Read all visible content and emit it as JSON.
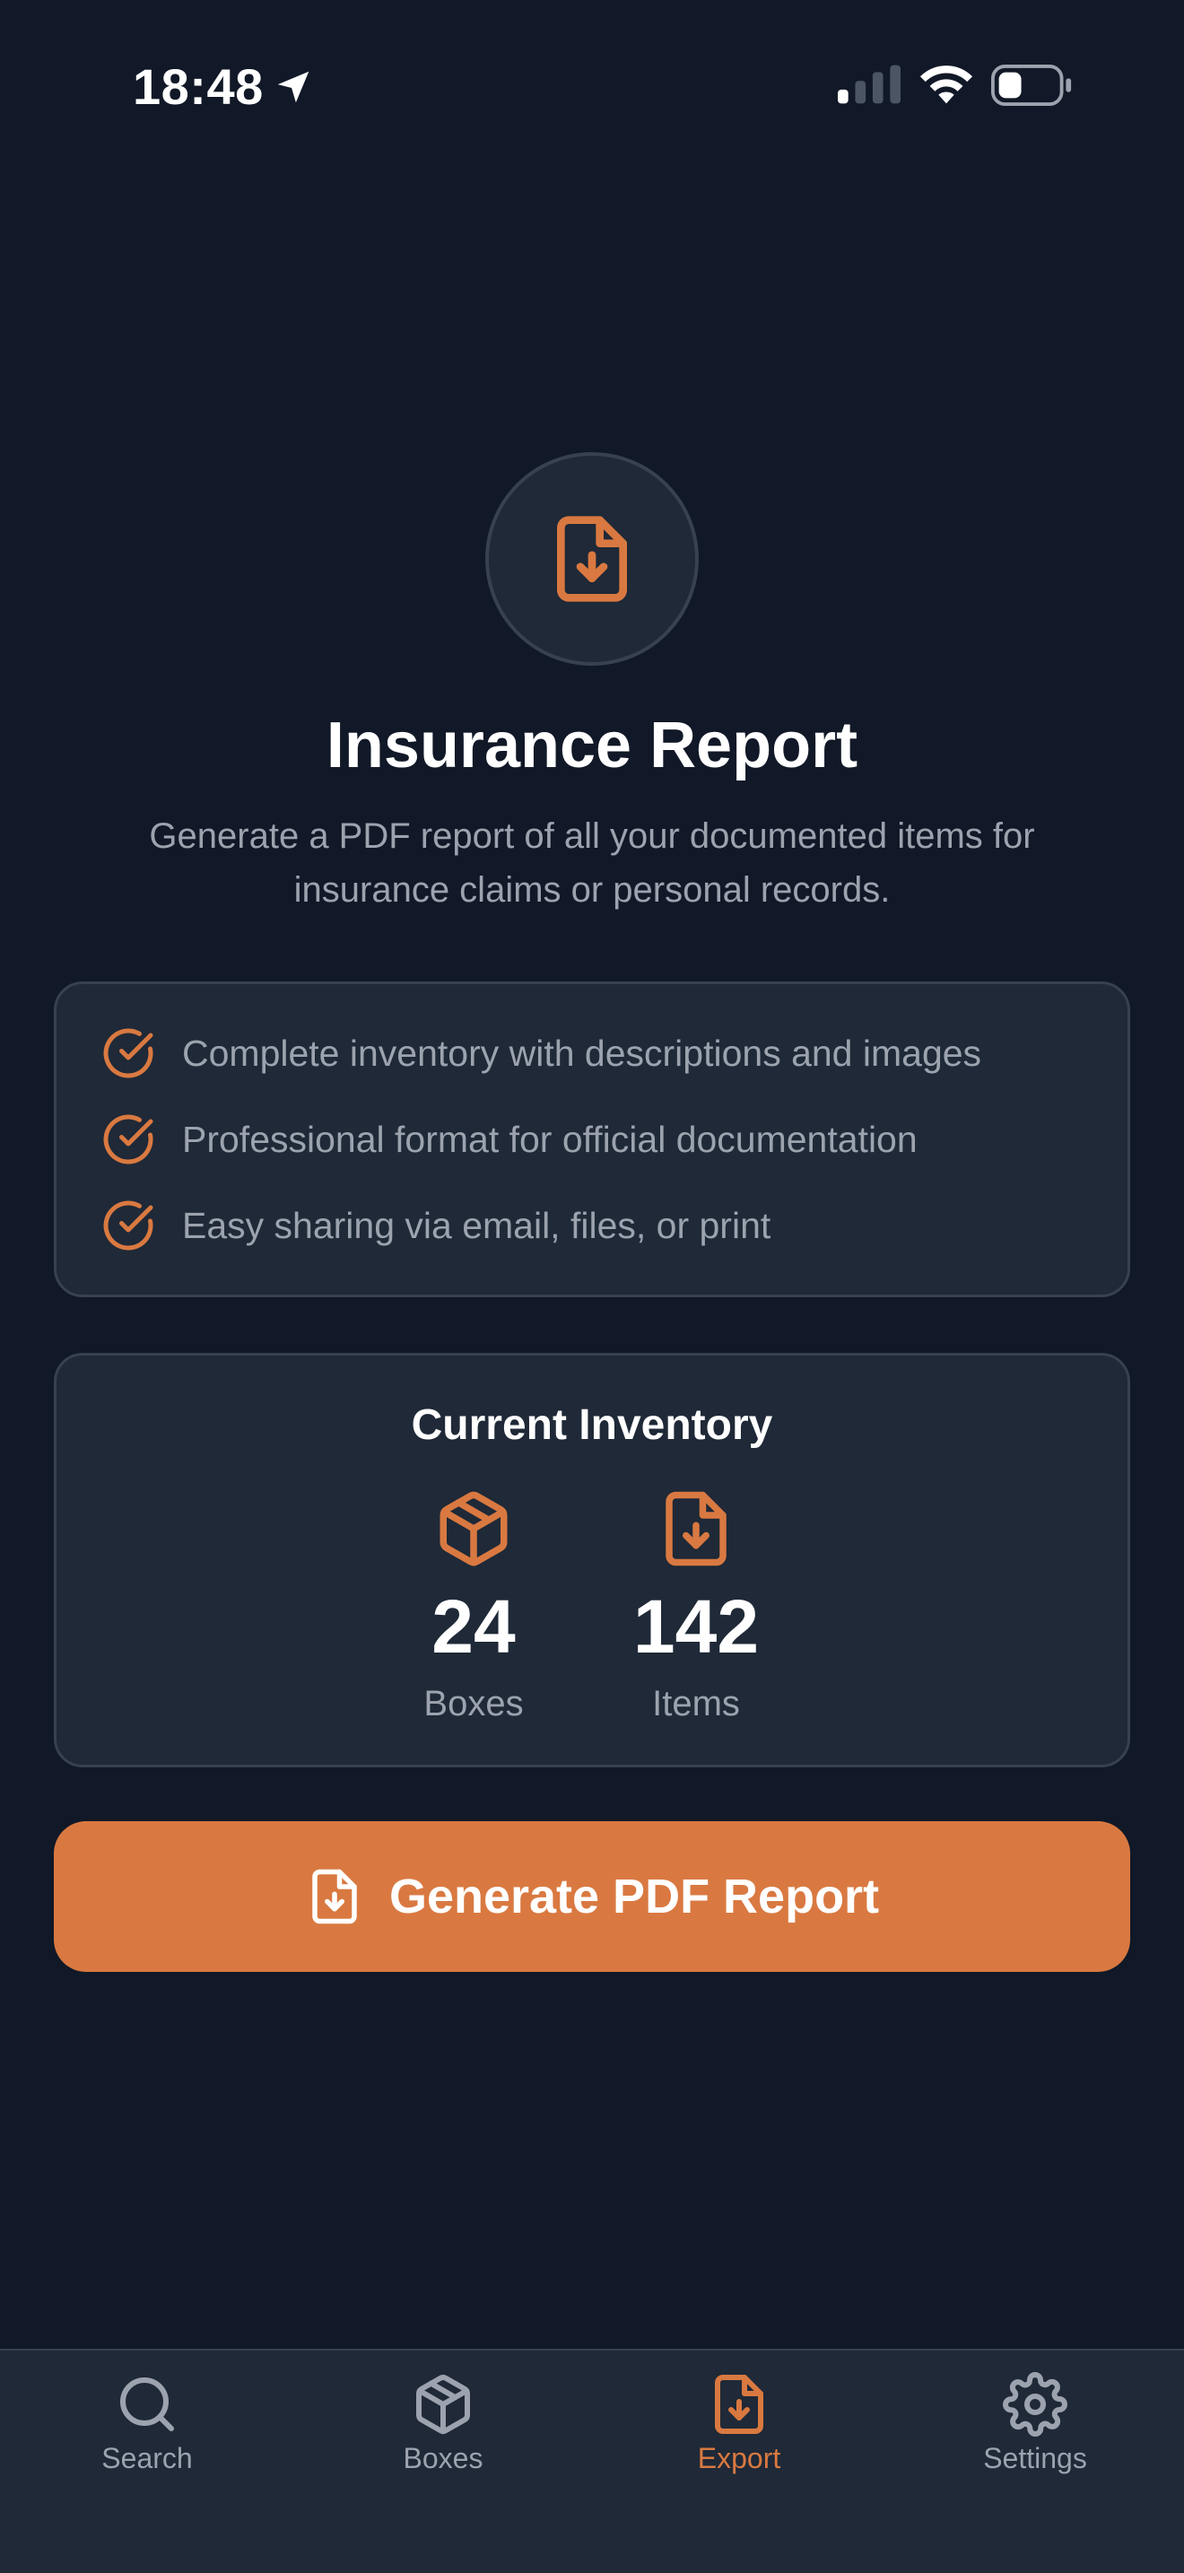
{
  "status_bar": {
    "time": "18:48"
  },
  "hero": {
    "title": "Insurance Report",
    "subtitle": "Generate a PDF report of all your documented items for insurance claims or personal records."
  },
  "features": [
    {
      "text": "Complete inventory with descriptions and images",
      "icon": "check-circle-icon"
    },
    {
      "text": "Professional format for official documentation",
      "icon": "check-circle-icon"
    },
    {
      "text": "Easy sharing via email, files, or print",
      "icon": "check-circle-icon"
    }
  ],
  "inventory": {
    "title": "Current Inventory",
    "stats": [
      {
        "value": "24",
        "label": "Boxes",
        "icon": "box-icon"
      },
      {
        "value": "142",
        "label": "Items",
        "icon": "file-download-icon"
      }
    ]
  },
  "actions": {
    "generate_label": "Generate PDF Report"
  },
  "tabs": [
    {
      "label": "Search",
      "icon": "search-icon",
      "active": false
    },
    {
      "label": "Boxes",
      "icon": "box-icon",
      "active": false
    },
    {
      "label": "Export",
      "icon": "file-download-icon",
      "active": true
    },
    {
      "label": "Settings",
      "icon": "gear-icon",
      "active": false
    }
  ],
  "colors": {
    "background": "#111827",
    "card": "#1f2937",
    "border": "#374151",
    "accent": "#d97941",
    "muted_text": "#9ca3af"
  }
}
